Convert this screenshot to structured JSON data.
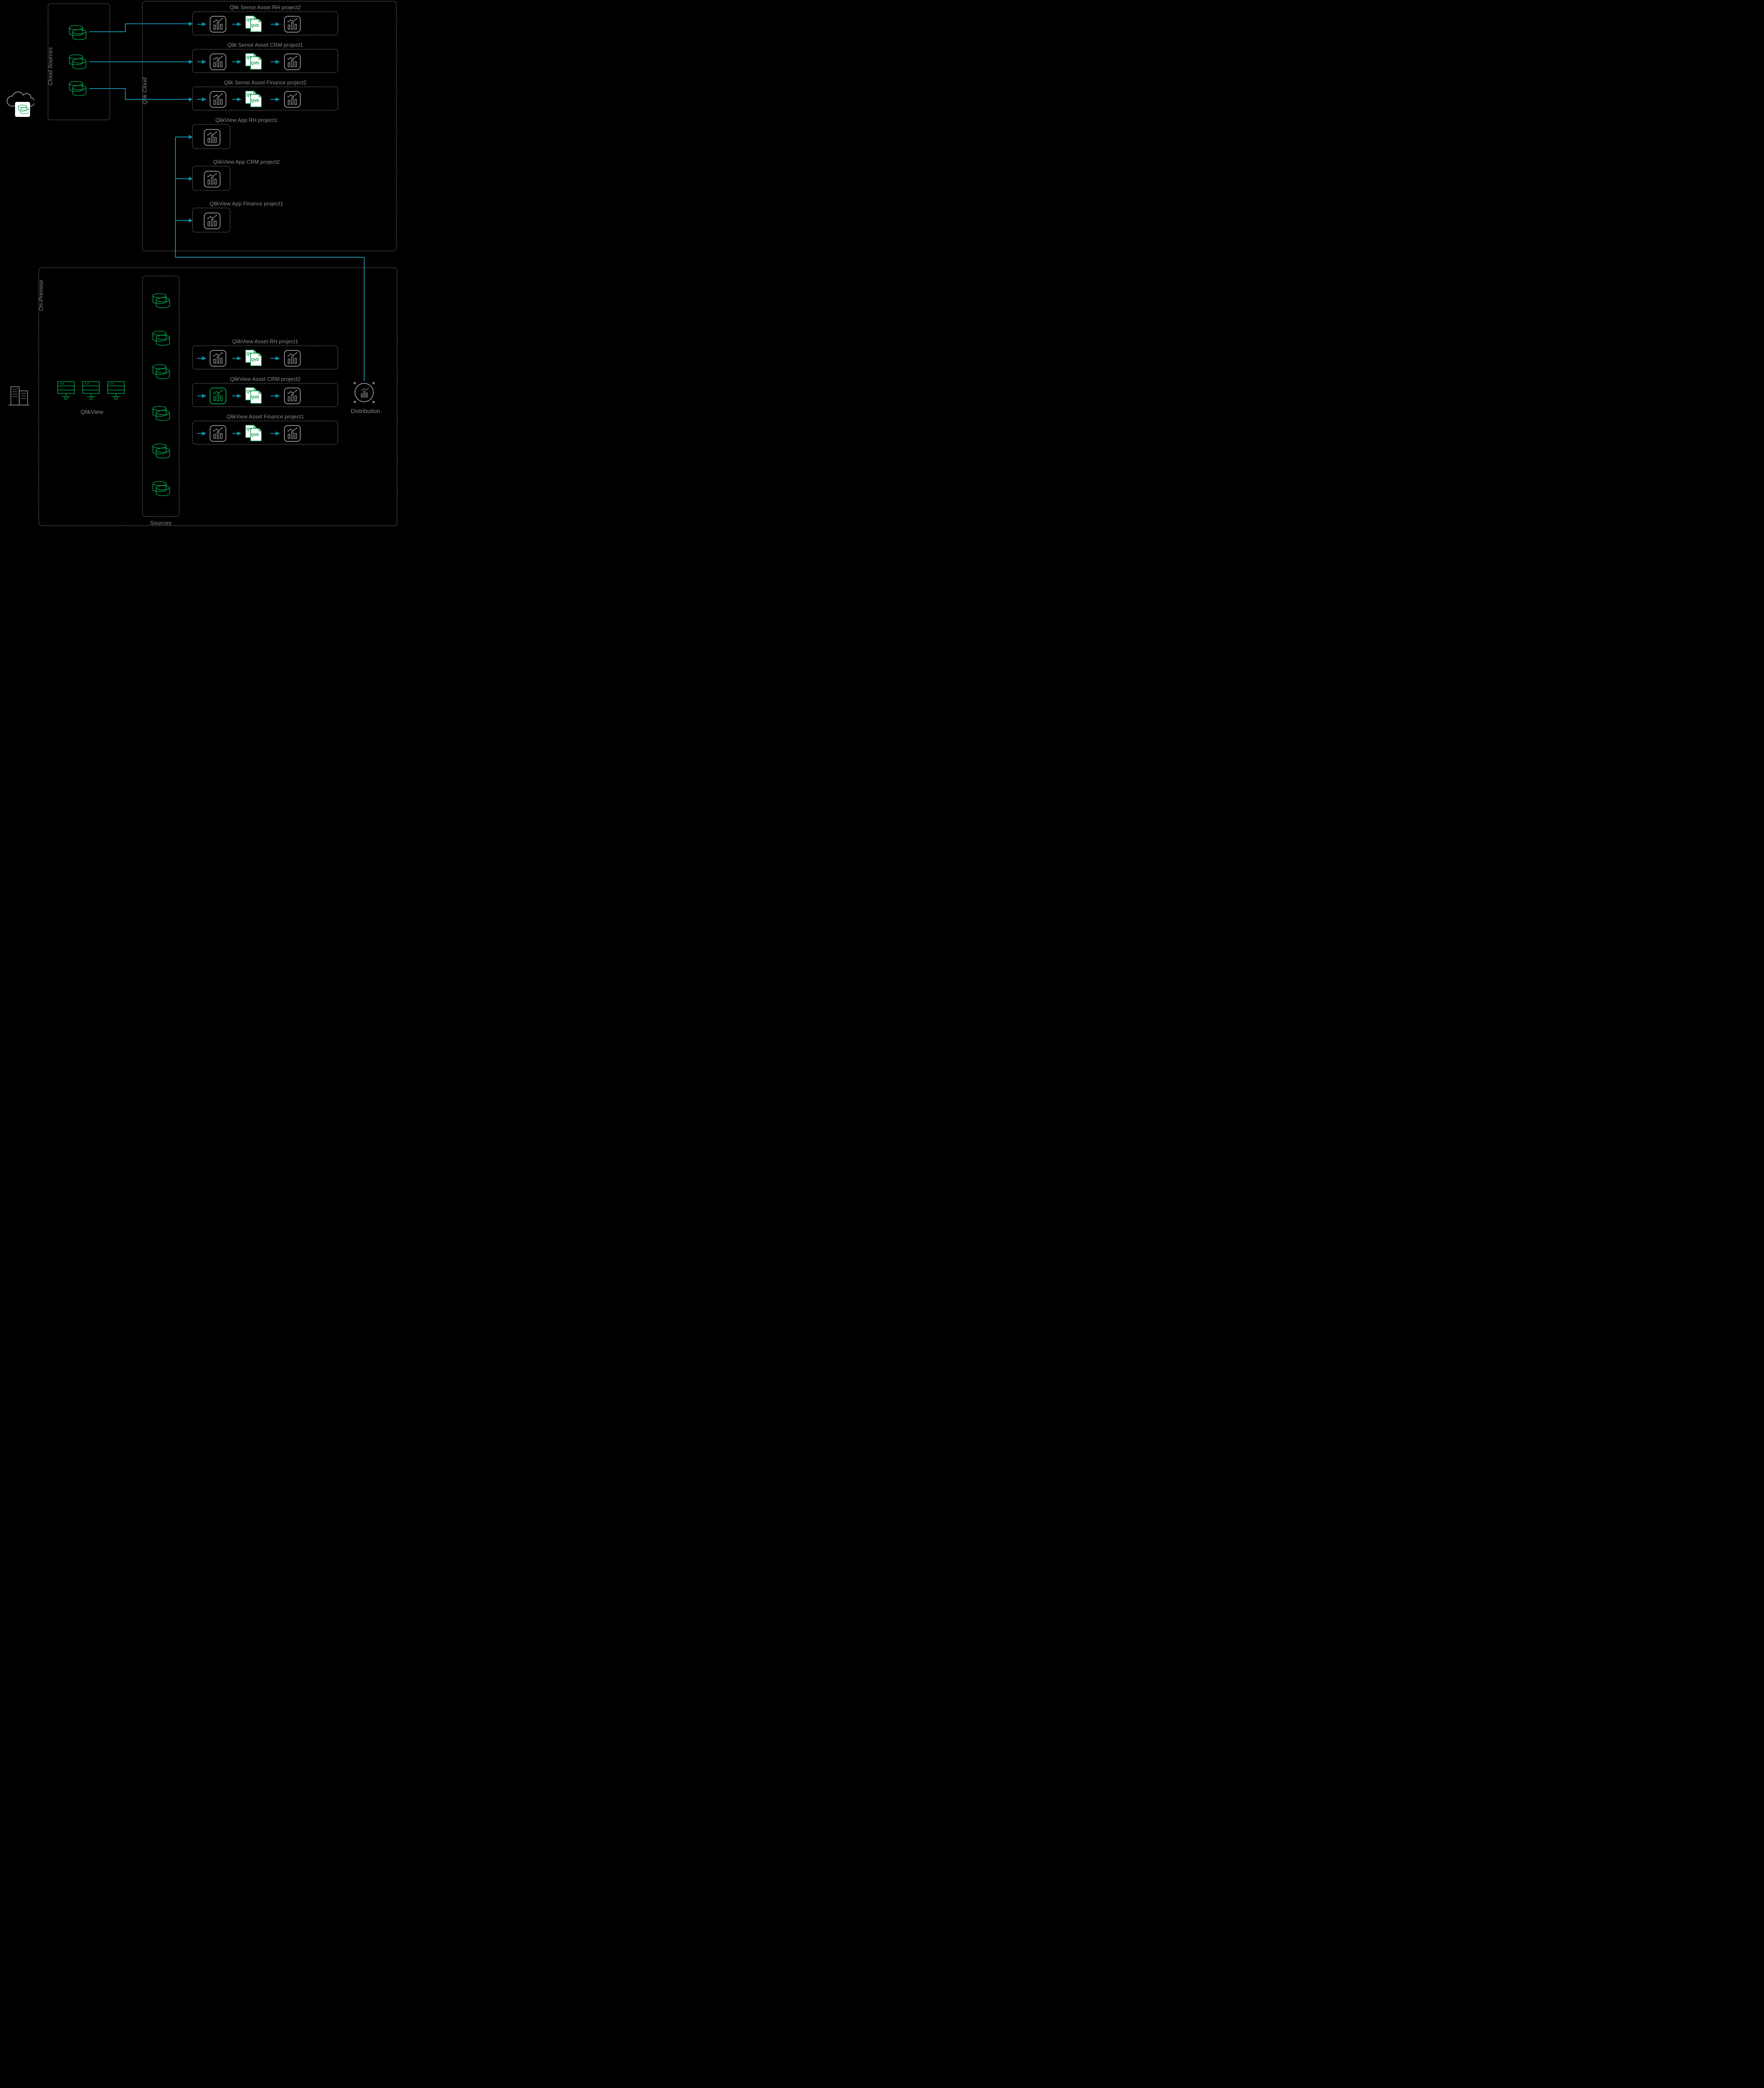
{
  "sections": {
    "cloud_sources_label": "Cloud Sources",
    "qlik_cloud_label": "Qlik Cloud",
    "on_premise_label": "On-Premise",
    "sources_label": "Sources",
    "qlikview_label": "QlikView",
    "distribution_label": "Distribution"
  },
  "cloud_assets": [
    {
      "title": "Qlik Sense Asset RH project2",
      "type": "full"
    },
    {
      "title": "Qlik Sense Asset CRM project1",
      "type": "full"
    },
    {
      "title": "Qlik Sense Asset Finance project2",
      "type": "full"
    },
    {
      "title": "QlikView App RH project1",
      "type": "single"
    },
    {
      "title": "QlikView App CRM project2",
      "type": "single"
    },
    {
      "title": "QlikView App Finance project1",
      "type": "single"
    }
  ],
  "onprem_assets": [
    {
      "title": "QlikView Asset RH project1",
      "type": "full"
    },
    {
      "title": "QlikView Asset CRM project2",
      "type": "full"
    },
    {
      "title": "QlikView Asset Finance project1",
      "type": "full"
    }
  ],
  "qvd_labels": {
    "qv": "QV",
    "qvd": "QVD"
  },
  "cloud_source_db_count": 3,
  "onprem_source_db_count": 6,
  "qlikview_server_count": 3
}
